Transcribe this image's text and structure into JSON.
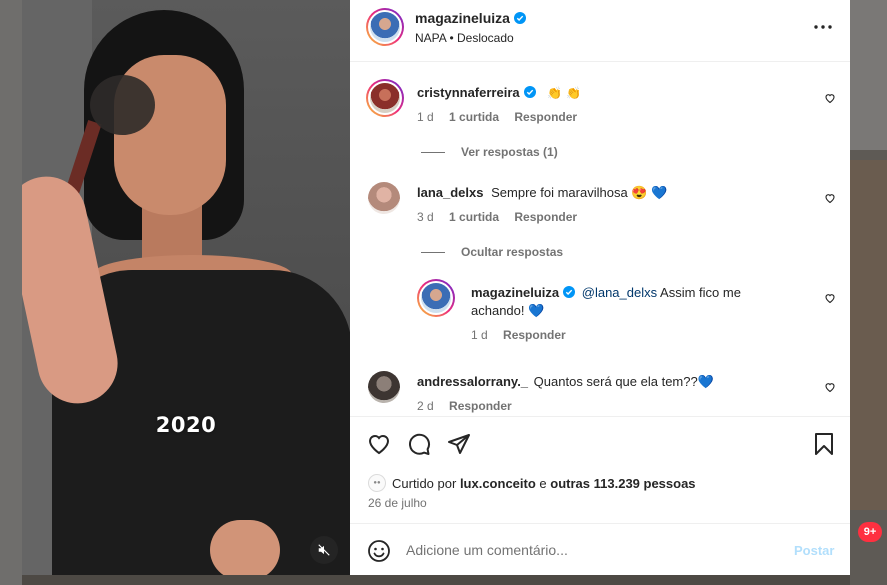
{
  "media": {
    "overlay_text": "2020"
  },
  "post": {
    "author": "magazineluiza",
    "location_line": "NAPA • Deslocado"
  },
  "comments": [
    {
      "username": "cristynnaferreira",
      "text": "👏 👏",
      "age": "1 d",
      "likes": "1 curtida",
      "reply_label": "Responder",
      "replies_toggle": "Ver respostas (1)"
    },
    {
      "username": "lana_delxs",
      "text": "Sempre foi maravilhosa 😍 💙",
      "age": "3 d",
      "likes": "1 curtida",
      "reply_label": "Responder",
      "replies_toggle": "Ocultar respostas",
      "replies": [
        {
          "username": "magazineluiza",
          "mention": "@lana_delxs",
          "text": "Assim fico me achando! 💙",
          "age": "1 d",
          "reply_label": "Responder"
        }
      ]
    },
    {
      "username": "andressalorrany._",
      "text": "Quantos será que ela tem??💙",
      "age": "2 d",
      "reply_label": "Responder"
    }
  ],
  "likes": {
    "prefix": "Curtido por",
    "user": "lux.conceito",
    "connector": "e",
    "others": "outras 113.239 pessoas"
  },
  "date": "26 de julho",
  "composer": {
    "placeholder": "Adicione um comentário...",
    "post_label": "Postar"
  },
  "notification_badge": "9+",
  "colors": {
    "verified": "#0095f6",
    "link": "#00376b",
    "post_disabled": "#b2dffc",
    "badge": "#ff3040"
  }
}
